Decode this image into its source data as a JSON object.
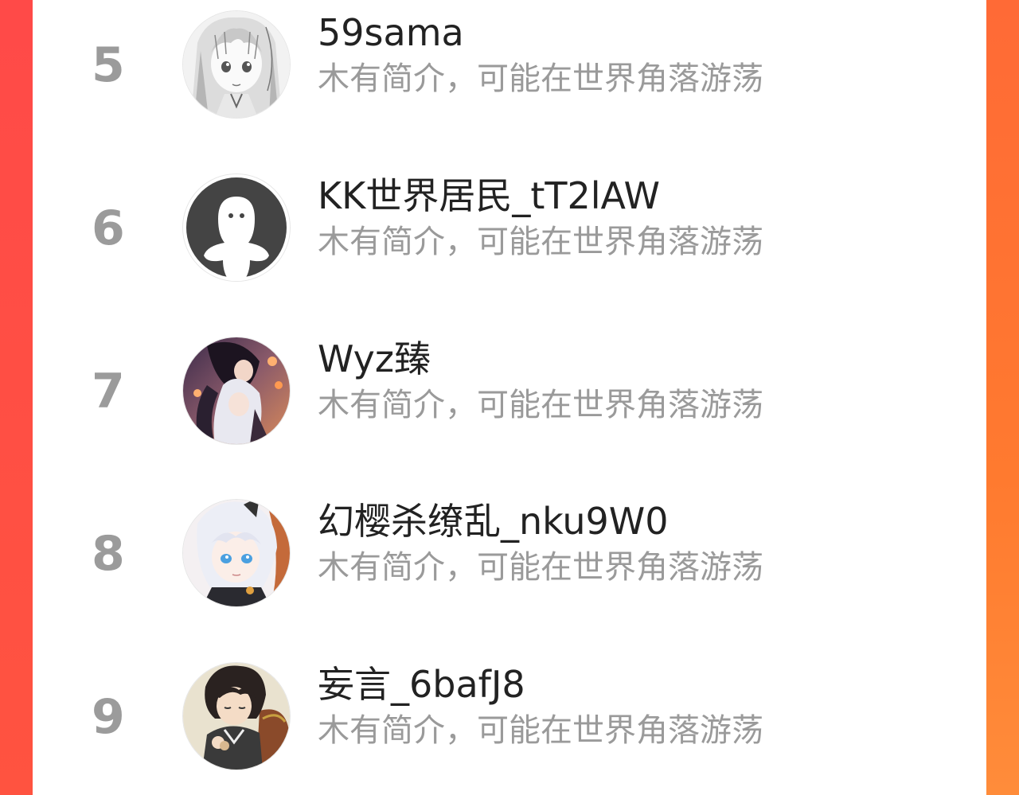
{
  "rankings": [
    {
      "rank": "5",
      "name": "59sama",
      "bio": "木有简介，可能在世界角落游荡",
      "avatar": "manga-girl-avatar-icon"
    },
    {
      "rank": "6",
      "name": "KK世界居民_tT2lAW",
      "bio": "木有简介，可能在世界角落游荡",
      "avatar": "default-ghost-avatar-icon"
    },
    {
      "rank": "7",
      "name": "Wyz臻",
      "bio": "木有简介，可能在世界角落游荡",
      "avatar": "anime-couple-avatar-icon"
    },
    {
      "rank": "8",
      "name": "幻樱杀缭乱_nku9W0",
      "bio": "木有简介，可能在世界角落游荡",
      "avatar": "white-hair-girl-avatar-icon"
    },
    {
      "rank": "9",
      "name": "妄言_6bafJ8",
      "bio": "木有简介，可能在世界角落游荡",
      "avatar": "dark-hair-boy-avatar-icon"
    }
  ],
  "colors": {
    "background_left": "#ff4b47",
    "background_right": "#ff7a35",
    "rank_number": "#9b9b9b",
    "name_text": "#222222",
    "bio_text": "#9a9a9a"
  }
}
